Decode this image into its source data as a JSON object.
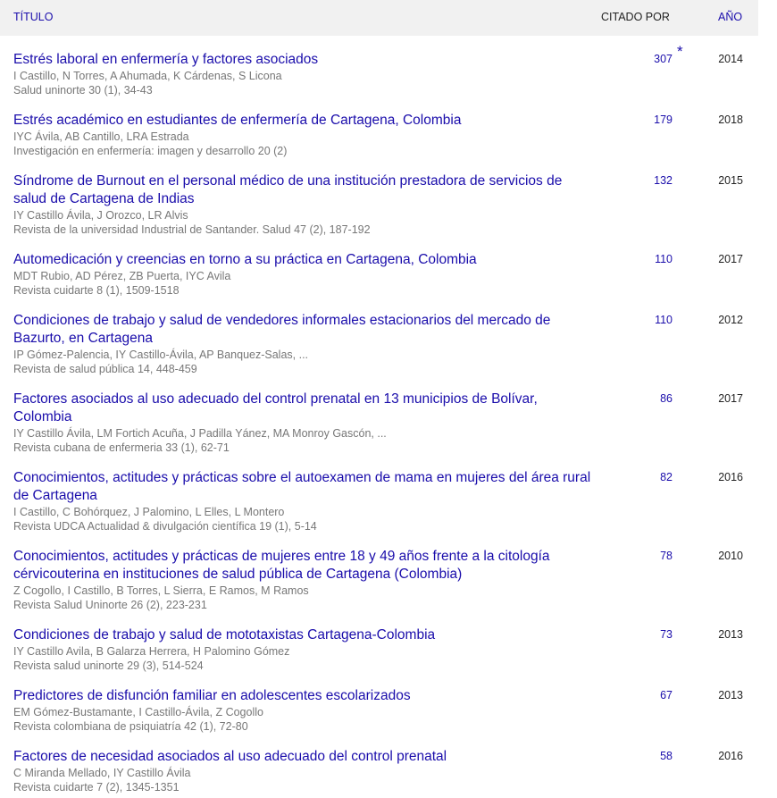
{
  "header": {
    "title_label": "TÍTULO",
    "cited_label": "CITADO POR",
    "year_label": "AÑO"
  },
  "articles": [
    {
      "title": "Estrés laboral en enfermería y factores asociados",
      "authors": "I Castillo, N Torres, A Ahumada, K Cárdenas, S Licona",
      "source": "Salud uninorte 30 (1), 34-43",
      "cited": "307",
      "year": "2014",
      "marker": "*"
    },
    {
      "title": "Estrés académico en estudiantes de enfermería de Cartagena, Colombia",
      "authors": "IYC Ávila, AB Cantillo, LRA Estrada",
      "source": "Investigación en enfermería: imagen y desarrollo 20 (2)",
      "cited": "179",
      "year": "2018"
    },
    {
      "title": "Síndrome de Burnout en el personal médico de una institución prestadora de servicios de salud de Cartagena de Indias",
      "authors": "IY Castillo Ávila, J Orozco, LR Alvis",
      "source": "Revista de la universidad Industrial de Santander. Salud 47 (2), 187-192",
      "cited": "132",
      "year": "2015"
    },
    {
      "title": "Automedicación y creencias en torno a su práctica en Cartagena, Colombia",
      "authors": "MDT Rubio, AD Pérez, ZB Puerta, IYC Avila",
      "source": "Revista cuidarte 8 (1), 1509-1518",
      "cited": "110",
      "year": "2017"
    },
    {
      "title": "Condiciones de trabajo y salud de vendedores informales estacionarios del mercado de Bazurto, en Cartagena",
      "authors": "IP Gómez-Palencia, IY Castillo-Ávila, AP Banquez-Salas, ...",
      "source": "Revista de salud pública 14, 448-459",
      "cited": "110",
      "year": "2012"
    },
    {
      "title": "Factores asociados al uso adecuado del control prenatal en 13 municipios de Bolívar, Colombia",
      "authors": "IY Castillo Ávila, LM Fortich Acuña, J Padilla Yánez, MA Monroy Gascón, ...",
      "source": "Revista cubana de enfermeria 33 (1), 62-71",
      "cited": "86",
      "year": "2017"
    },
    {
      "title": "Conocimientos, actitudes y prácticas sobre el autoexamen de mama en mujeres del área rural de Cartagena",
      "authors": "I Castillo, C Bohórquez, J Palomino, L Elles, L Montero",
      "source": "Revista UDCA Actualidad & divulgación científica 19 (1), 5-14",
      "cited": "82",
      "year": "2016"
    },
    {
      "title": "Conocimientos, actitudes y prácticas de mujeres entre 18 y 49 años frente a la citología cérvicouterina en instituciones de salud pública de Cartagena (Colombia)",
      "authors": "Z Cogollo, I Castillo, B Torres, L Sierra, E Ramos, M Ramos",
      "source": "Revista Salud Uninorte 26 (2), 223-231",
      "cited": "78",
      "year": "2010"
    },
    {
      "title": "Condiciones de trabajo y salud de mototaxistas Cartagena-Colombia",
      "authors": "IY Castillo Avila, B Galarza Herrera, H Palomino Gómez",
      "source": "Revista salud uninorte 29 (3), 514-524",
      "cited": "73",
      "year": "2013"
    },
    {
      "title": "Predictores de disfunción familiar en adolescentes escolarizados",
      "authors": "EM Gómez-Bustamante, I Castillo-Ávila, Z Cogollo",
      "source": "Revista colombiana de psiquiatría 42 (1), 72-80",
      "cited": "67",
      "year": "2013"
    },
    {
      "title": "Factores de necesidad asociados al uso adecuado del control prenatal",
      "authors": "C Miranda Mellado, IY Castillo Ávila",
      "source": "Revista cuidarte 7 (2), 1345-1351",
      "cited": "58",
      "year": "2016"
    }
  ]
}
